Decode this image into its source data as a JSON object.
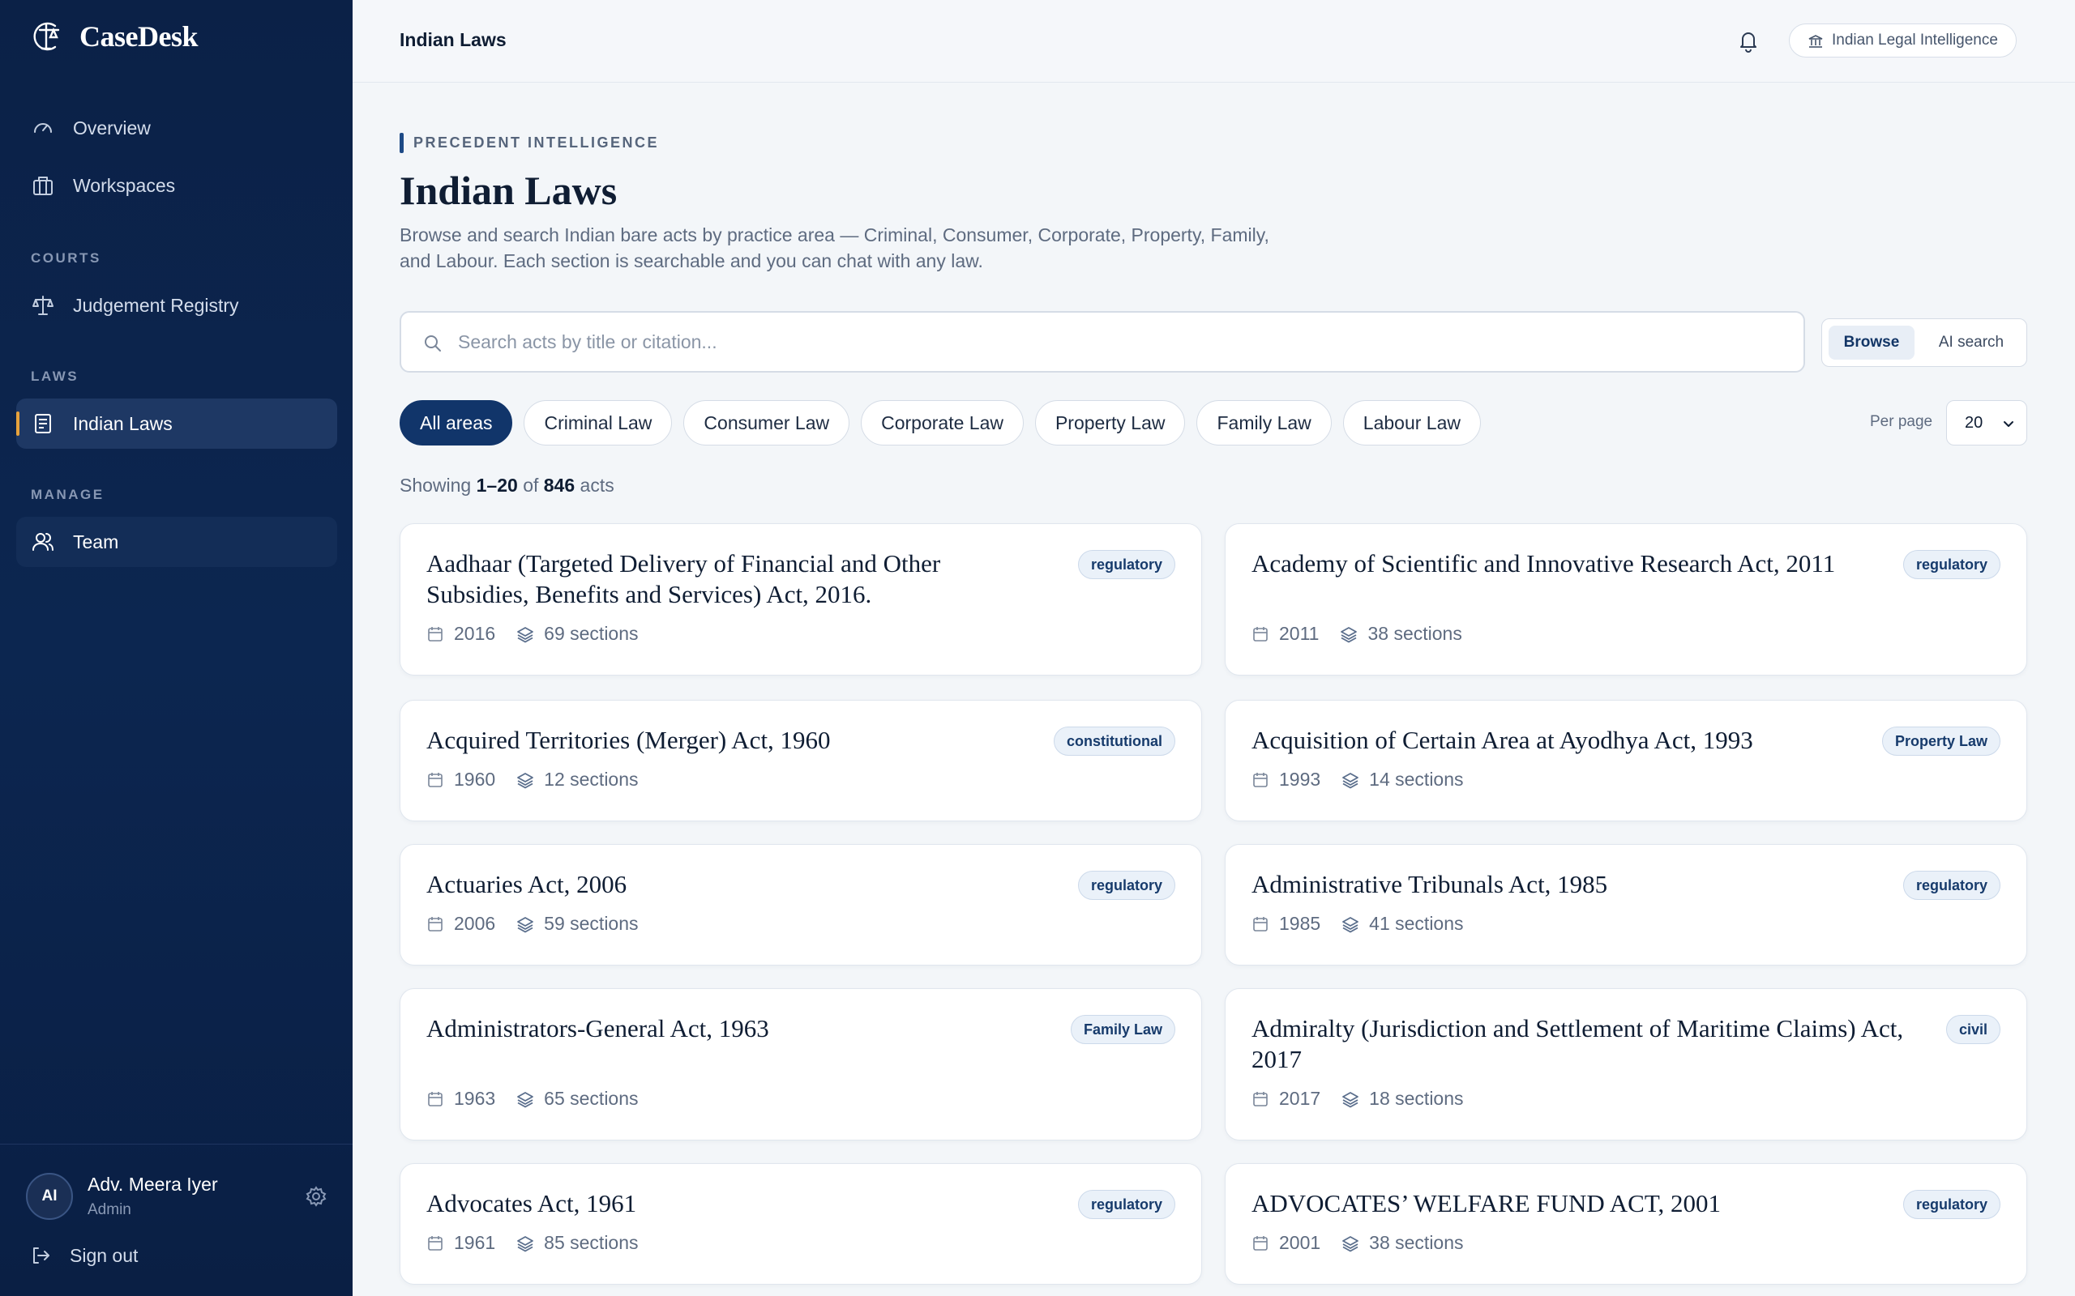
{
  "app": {
    "name": "CaseDesk"
  },
  "sidebar": {
    "items": [
      {
        "label": "Overview"
      },
      {
        "label": "Workspaces"
      }
    ],
    "sections": {
      "courts": "COURTS",
      "laws": "LAWS",
      "manage": "MANAGE"
    },
    "courts_items": [
      {
        "label": "Judgement Registry"
      }
    ],
    "laws_items": [
      {
        "label": "Indian Laws"
      }
    ],
    "manage_items": [
      {
        "label": "Team"
      }
    ],
    "user": {
      "initials": "AI",
      "name": "Adv. Meera Iyer",
      "role": "Admin"
    },
    "signout_label": "Sign out"
  },
  "topbar": {
    "title": "Indian Laws",
    "org_label": "Indian Legal Intelligence"
  },
  "main": {
    "eyebrow": "PRECEDENT INTELLIGENCE",
    "title": "Indian Laws",
    "description": "Browse and search Indian bare acts by practice area — Criminal, Consumer, Corporate, Property, Family, and Labour. Each section is searchable and you can chat with any law.",
    "search_placeholder": "Search acts by title or citation...",
    "mode": {
      "browse": "Browse",
      "ai": "AI search"
    },
    "filters": [
      "All areas",
      "Criminal Law",
      "Consumer Law",
      "Corporate Law",
      "Property Law",
      "Family Law",
      "Labour Law"
    ],
    "per_page_label": "Per page",
    "per_page_value": "20",
    "showing": {
      "prefix": "Showing",
      "range": "1–20",
      "of": "of",
      "total": "846",
      "suffix": "acts"
    },
    "acts": [
      {
        "title": "Aadhaar (Targeted Delivery of Financial and Other Subsidies, Benefits and Services) Act, 2016.",
        "badge": "regulatory",
        "year": "2016",
        "sections": "69 sections"
      },
      {
        "title": "Academy of Scientific and Innovative Research Act, 2011",
        "badge": "regulatory",
        "year": "2011",
        "sections": "38 sections"
      },
      {
        "title": "Acquired Territories (Merger) Act, 1960",
        "badge": "constitutional",
        "year": "1960",
        "sections": "12 sections"
      },
      {
        "title": "Acquisition of Certain Area at Ayodhya Act, 1993",
        "badge": "Property Law",
        "year": "1993",
        "sections": "14 sections"
      },
      {
        "title": "Actuaries Act, 2006",
        "badge": "regulatory",
        "year": "2006",
        "sections": "59 sections"
      },
      {
        "title": "Administrative Tribunals Act, 1985",
        "badge": "regulatory",
        "year": "1985",
        "sections": "41 sections"
      },
      {
        "title": "Administrators-General Act, 1963",
        "badge": "Family Law",
        "year": "1963",
        "sections": "65 sections"
      },
      {
        "title": "Admiralty (Jurisdiction and Settlement of Maritime Claims) Act, 2017",
        "badge": "civil",
        "year": "2017",
        "sections": "18 sections"
      },
      {
        "title": "Advocates Act, 1961",
        "badge": "regulatory",
        "year": "1961",
        "sections": "85 sections"
      },
      {
        "title": "ADVOCATES’ WELFARE FUND ACT, 2001",
        "badge": "regulatory",
        "year": "2001",
        "sections": "38 sections"
      }
    ]
  },
  "colors": {
    "sidebar_bg": "#0c2650",
    "accent": "#11356a",
    "active_marker": "#e6a23c"
  }
}
